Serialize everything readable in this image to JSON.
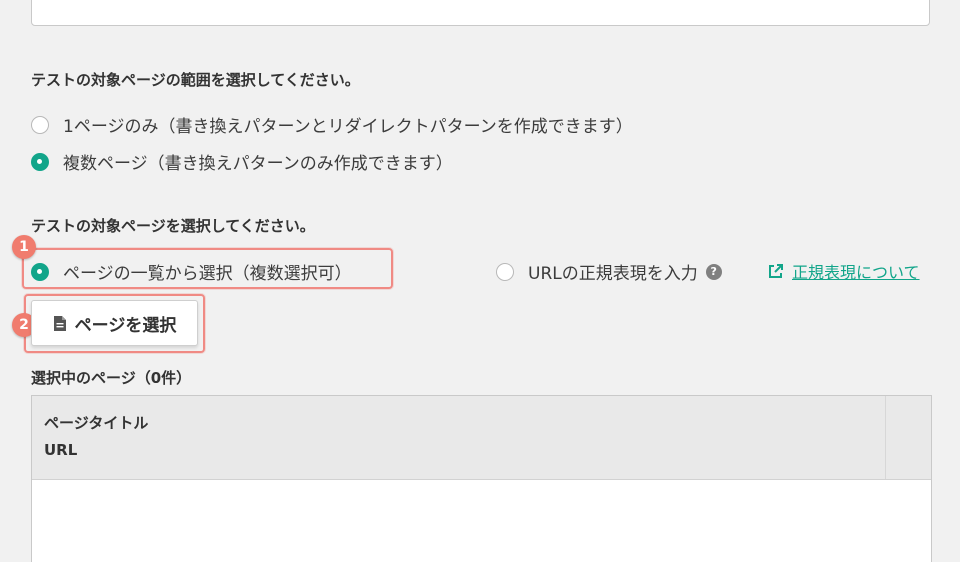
{
  "range_section": {
    "label": "テストの対象ページの範囲を選択してください。",
    "options": [
      {
        "label": "1ページのみ（書き換えパターンとリダイレクトパターンを作成できます）",
        "checked": false
      },
      {
        "label": "複数ページ（書き換えパターンのみ作成できます）",
        "checked": true
      }
    ]
  },
  "target_section": {
    "label": "テストの対象ページを選択してください。",
    "options": [
      {
        "label": "ページの一覧から選択（複数選択可）",
        "checked": true
      },
      {
        "label": "URLの正規表現を入力",
        "checked": false
      }
    ],
    "help_icon": "question-icon",
    "regex_link": {
      "label": "正規表現について",
      "icon": "external-link-icon"
    }
  },
  "select_button": {
    "label": "ページを選択",
    "icon": "document-icon"
  },
  "selected_pages": {
    "label": "選択中のページ（0件）",
    "columns": [
      "ページタイトル",
      "URL"
    ]
  },
  "annotations": [
    "1",
    "2"
  ],
  "colors": {
    "accent": "#12a58a",
    "highlight": "#f08a84",
    "badge": "#f07c6e"
  }
}
